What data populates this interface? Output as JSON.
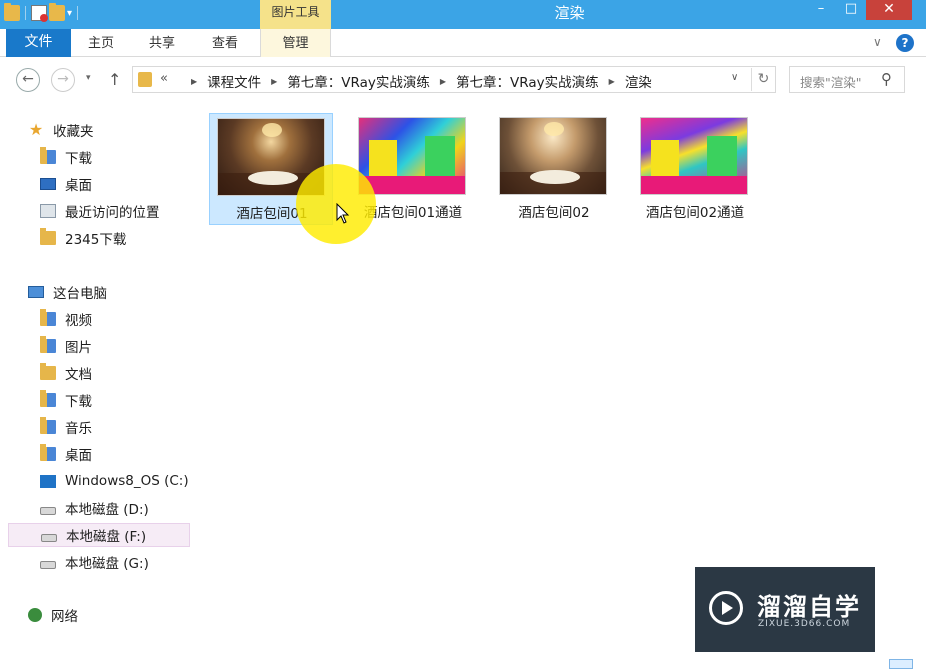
{
  "window": {
    "title": "渲染",
    "contextual_tab_group": "图片工具",
    "controls": {
      "minimize": "–",
      "maximize": "□",
      "close": "✕"
    }
  },
  "quick_access_toolbar": {
    "dropdown": "▾"
  },
  "ribbon": {
    "tabs": {
      "file": "文件",
      "home": "主页",
      "share": "共享",
      "view": "查看",
      "manage": "管理"
    },
    "collapse": "∨",
    "help": "?"
  },
  "navigation": {
    "back": "←",
    "forward": "→",
    "recent": "▾",
    "up": "↑"
  },
  "address_bar": {
    "overflow": "«",
    "crumbs": [
      "课程文件",
      "第七章：VRay实战演练",
      "第七章：VRay实战演练",
      "渲染"
    ],
    "separator": "▶",
    "dropdown": "∨",
    "refresh": "↻"
  },
  "search": {
    "placeholder": "搜索\"渲染\"",
    "icon": "search-icon"
  },
  "nav_pane": {
    "favorites": {
      "label": "收藏夹",
      "items": [
        "下载",
        "桌面",
        "最近访问的位置",
        "2345下载"
      ]
    },
    "this_pc": {
      "label": "这台电脑",
      "items": [
        "视频",
        "图片",
        "文档",
        "下载",
        "音乐",
        "桌面",
        "Windows8_OS (C:)",
        "本地磁盘 (D:)",
        "本地磁盘 (F:)",
        "本地磁盘 (G:)"
      ]
    },
    "network": {
      "label": "网络"
    }
  },
  "files": [
    {
      "name": "酒店包间01",
      "selected": true
    },
    {
      "name": "酒店包间01通道",
      "selected": false
    },
    {
      "name": "酒店包间02",
      "selected": false
    },
    {
      "name": "酒店包间02通道",
      "selected": false
    }
  ],
  "watermark": {
    "title": "溜溜自学",
    "subtitle": "ZIXUE.3D66.COM"
  },
  "colors": {
    "titlebar": "#3ba4e6",
    "file_tab": "#1979ca",
    "contextual_tab": "#f5e28a",
    "selection": "#cce8ff",
    "close_button": "#c8423b",
    "cursor_highlight": "#ffec00"
  }
}
